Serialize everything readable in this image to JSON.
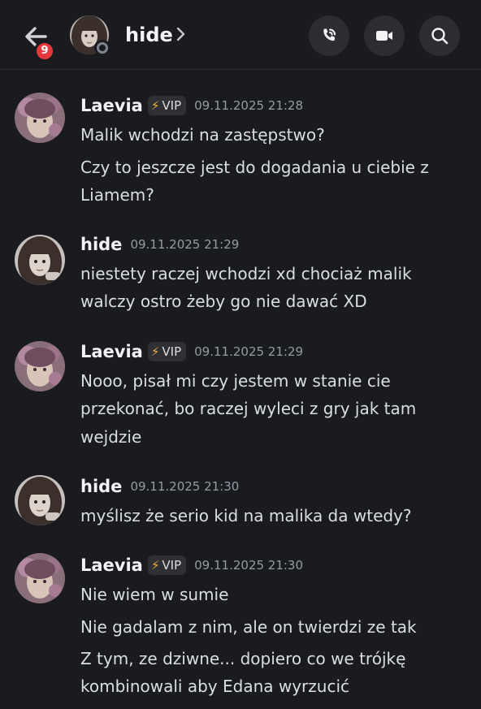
{
  "header": {
    "back_badge": "9",
    "title": "hide",
    "title_chevron_icon": "chevron-right-icon",
    "call_icon": "phone-call-icon",
    "video_icon": "video-camera-icon",
    "search_icon": "search-icon",
    "status": "offline"
  },
  "messages": [
    {
      "author": "Laevia",
      "badge": "VIP",
      "time": "09.11.2025 21:28",
      "lines": [
        "Malik wchodzi na zastępstwo?",
        "Czy to jeszcze jest do dogadania u ciebie z",
        "Liamem?"
      ]
    },
    {
      "author": "hide",
      "time": "09.11.2025 21:29",
      "lines": [
        "niestety raczej wchodzi xd chociaż malik",
        "walczy ostro żeby go nie dawać XD"
      ]
    },
    {
      "author": "Laevia",
      "badge": "VIP",
      "time": "09.11.2025 21:29",
      "lines": [
        "Nooo, pisał mi czy jestem w stanie cie",
        "przekonać, bo raczej wyleci z gry jak tam",
        "wejdzie"
      ]
    },
    {
      "author": "hide",
      "time": "09.11.2025 21:30",
      "lines": [
        "myślisz że serio kid na malika da wtedy?"
      ]
    },
    {
      "author": "Laevia",
      "badge": "VIP",
      "time": "09.11.2025 21:30",
      "lines": [
        "Nie wiem w sumie",
        "Nie gadalam z nim, ale on twierdzi ze tak",
        "Z tym, ze dziwne... dopiero co we trójkę",
        "kombinowali aby Edana wyrzucić"
      ]
    }
  ],
  "colors": {
    "background": "#1a1b1f",
    "badge_red": "#e5383e",
    "vip_bolt": "#f0b232",
    "timestamp": "#949ba4"
  }
}
